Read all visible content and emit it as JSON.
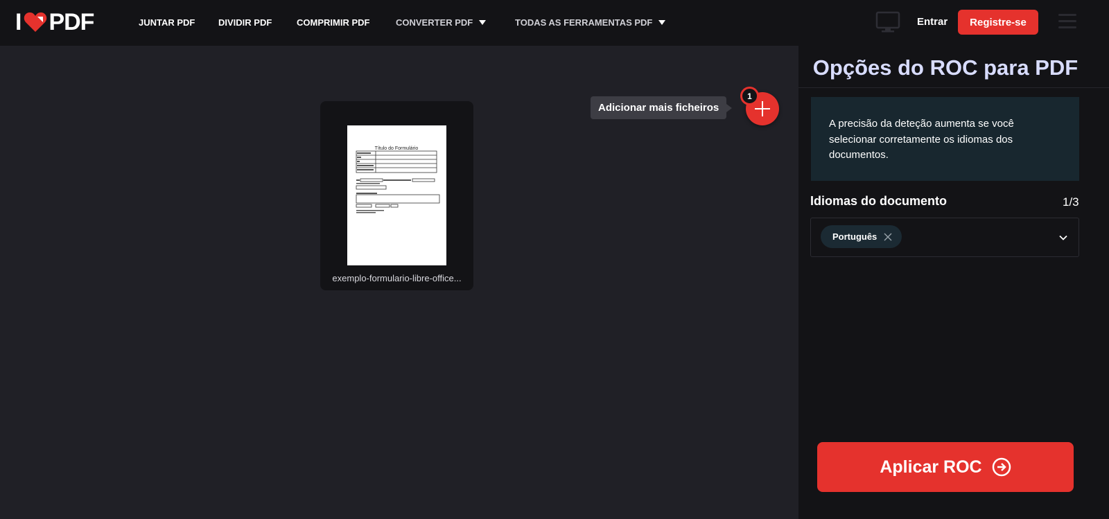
{
  "header": {
    "logo_left": "I",
    "logo_right": "PDF",
    "nav": [
      {
        "label": "JUNTAR PDF"
      },
      {
        "label": "DIVIDIR PDF"
      },
      {
        "label": "COMPRIMIR PDF"
      },
      {
        "label": "CONVERTER PDF"
      },
      {
        "label": "TODAS AS FERRAMENTAS PDF"
      }
    ],
    "login_label": "Entrar",
    "register_label": "Registre-se"
  },
  "workspace": {
    "file": {
      "name": "exemplo-formulario-libre-office...",
      "thumbnail_title": "Título do Formulário"
    },
    "add_tooltip": "Adicionar mais ficheiros",
    "file_count": "1"
  },
  "sidebar": {
    "title": "Opções do ROC para PDF",
    "info_text": "A precisão da deteção aumenta se você selecionar corretamente os idiomas dos documentos.",
    "languages_label": "Idiomas do documento",
    "languages_count": "1/3",
    "selected_languages": [
      "Português"
    ],
    "apply_label": "Aplicar ROC"
  },
  "colors": {
    "brand_red": "#e5322d",
    "header_bg": "#131316",
    "workspace_bg": "#202026",
    "info_bg": "#18272f"
  }
}
